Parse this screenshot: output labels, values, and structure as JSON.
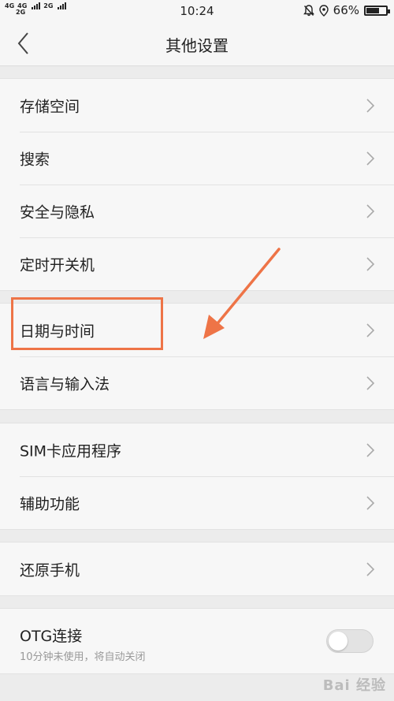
{
  "status_bar": {
    "signal_1": "4G",
    "signal_2": "4G",
    "signal_2_sub": "2G",
    "signal_3": "2G",
    "time": "10:24",
    "battery_percent": "66%",
    "battery_level": 0.66
  },
  "header": {
    "back_icon": "chevron-left-icon",
    "title": "其他设置"
  },
  "groups": [
    {
      "items": [
        {
          "label": "存储空间"
        },
        {
          "label": "搜索"
        },
        {
          "label": "安全与隐私"
        },
        {
          "label": "定时开关机"
        }
      ]
    },
    {
      "items": [
        {
          "label": "日期与时间"
        },
        {
          "label": "语言与输入法"
        }
      ]
    },
    {
      "items": [
        {
          "label": "SIM卡应用程序"
        },
        {
          "label": "辅助功能"
        }
      ]
    },
    {
      "items": [
        {
          "label": "还原手机"
        }
      ]
    }
  ],
  "otg": {
    "title": "OTG连接",
    "subtitle": "10分钟未使用，将自动关闭",
    "enabled": false
  },
  "annotation": {
    "color": "#ee7447"
  },
  "watermark": {
    "text": "Bai 经验"
  }
}
